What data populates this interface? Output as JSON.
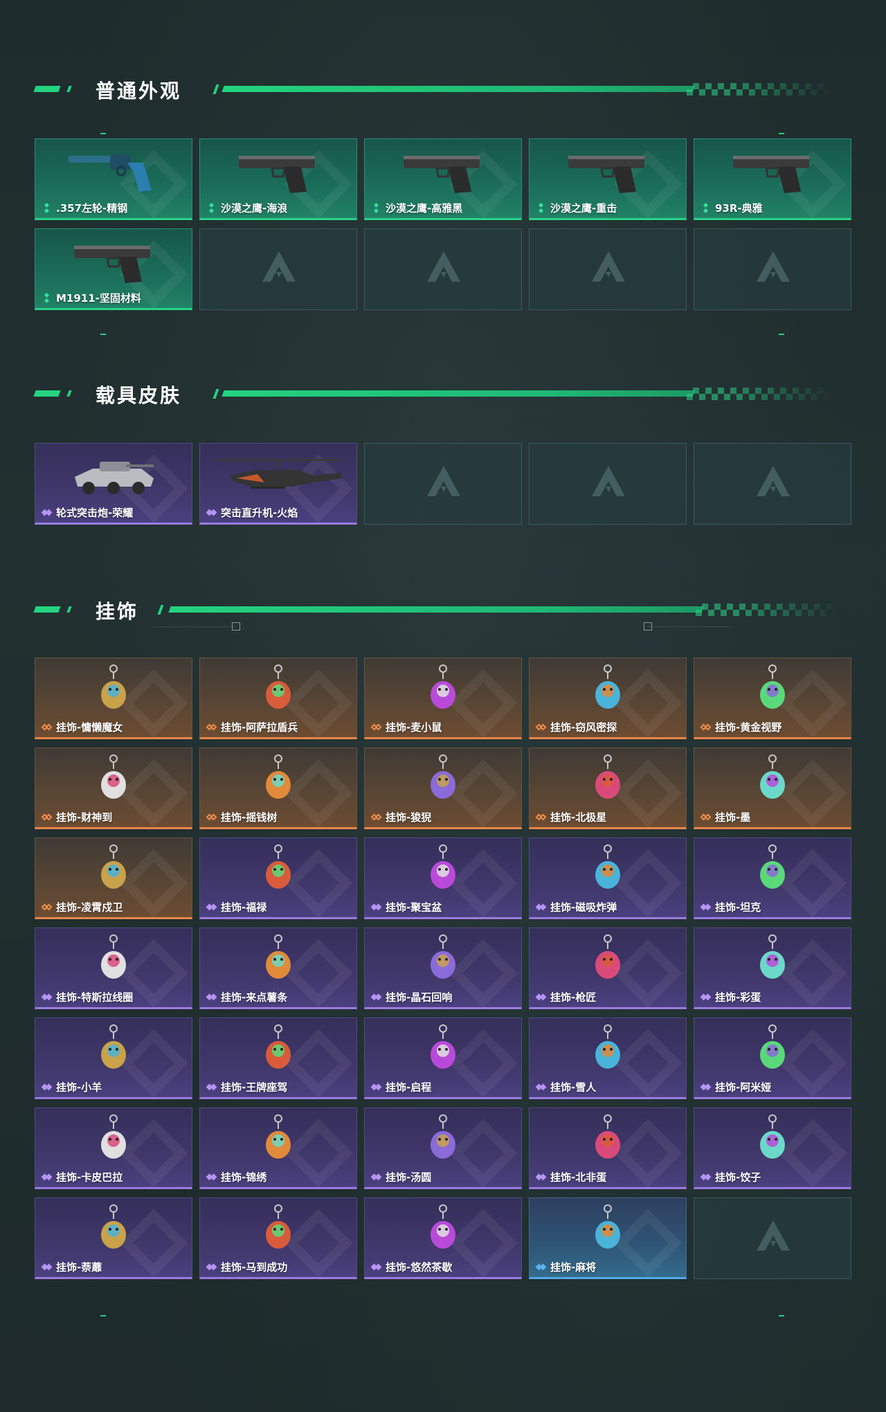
{
  "sections": {
    "weapons": {
      "title": "普通外观"
    },
    "vehicles": {
      "title": "载具皮肤"
    },
    "charms": {
      "title": "挂饰"
    }
  },
  "weapons": [
    {
      "name": ".357左轮-精钢",
      "rarity": "green",
      "icon": "revolver-icon"
    },
    {
      "name": "沙漠之鹰-海浪",
      "rarity": "green",
      "icon": "pistol-icon"
    },
    {
      "name": "沙漠之鹰-高雅黑",
      "rarity": "green",
      "icon": "pistol-icon"
    },
    {
      "name": "沙漠之鹰-重击",
      "rarity": "green",
      "icon": "pistol-icon"
    },
    {
      "name": "93R-典雅",
      "rarity": "green",
      "icon": "pistol-icon"
    },
    {
      "name": "M1911-坚固材料",
      "rarity": "green",
      "icon": "pistol-icon"
    }
  ],
  "vehicles": [
    {
      "name": "轮式突击炮-荣耀",
      "rarity": "purple",
      "icon": "armored-vehicle-icon"
    },
    {
      "name": "突击直升机-火焰",
      "rarity": "purple",
      "icon": "helicopter-icon"
    }
  ],
  "charms": [
    {
      "name": "挂饰-慵懒魔女",
      "rarity": "orange"
    },
    {
      "name": "挂饰-阿萨拉盾兵",
      "rarity": "orange"
    },
    {
      "name": "挂饰-麦小鼠",
      "rarity": "orange"
    },
    {
      "name": "挂饰-窃风密探",
      "rarity": "orange"
    },
    {
      "name": "挂饰-黄金视野",
      "rarity": "orange"
    },
    {
      "name": "挂饰-财神到",
      "rarity": "orange"
    },
    {
      "name": "挂饰-摇钱树",
      "rarity": "orange"
    },
    {
      "name": "挂饰-狻猊",
      "rarity": "orange"
    },
    {
      "name": "挂饰-北极星",
      "rarity": "orange"
    },
    {
      "name": "挂饰-墨",
      "rarity": "orange"
    },
    {
      "name": "挂饰-凌霄戍卫",
      "rarity": "orange"
    },
    {
      "name": "挂饰-福禄",
      "rarity": "purple"
    },
    {
      "name": "挂饰-聚宝盆",
      "rarity": "purple"
    },
    {
      "name": "挂饰-磁吸炸弹",
      "rarity": "purple"
    },
    {
      "name": "挂饰-坦克",
      "rarity": "purple"
    },
    {
      "name": "挂饰-特斯拉线圈",
      "rarity": "purple"
    },
    {
      "name": "挂饰-来点薯条",
      "rarity": "purple"
    },
    {
      "name": "挂饰-晶石回响",
      "rarity": "purple"
    },
    {
      "name": "挂饰-枪匠",
      "rarity": "purple"
    },
    {
      "name": "挂饰-彩蛋",
      "rarity": "purple"
    },
    {
      "name": "挂饰-小羊",
      "rarity": "purple"
    },
    {
      "name": "挂饰-王牌座驾",
      "rarity": "purple"
    },
    {
      "name": "挂饰-启程",
      "rarity": "purple"
    },
    {
      "name": "挂饰-雪人",
      "rarity": "purple"
    },
    {
      "name": "挂饰-阿米娅",
      "rarity": "purple"
    },
    {
      "name": "挂饰-卡皮巴拉",
      "rarity": "purple"
    },
    {
      "name": "挂饰-锦绣",
      "rarity": "purple"
    },
    {
      "name": "挂饰-汤圆",
      "rarity": "purple"
    },
    {
      "name": "挂饰-北非蛋",
      "rarity": "purple"
    },
    {
      "name": "挂饰-饺子",
      "rarity": "purple"
    },
    {
      "name": "挂饰-萘蘼",
      "rarity": "purple"
    },
    {
      "name": "挂饰-马到成功",
      "rarity": "purple"
    },
    {
      "name": "挂饰-悠然茶歇",
      "rarity": "purple"
    },
    {
      "name": "挂饰-麻将",
      "rarity": "blue"
    }
  ],
  "colors": {
    "accent": "#22d37f",
    "green_rarity": "#27d488",
    "purple_rarity": "#9c7be0",
    "orange_rarity": "#e8874a",
    "blue_rarity": "#52a8e8"
  }
}
